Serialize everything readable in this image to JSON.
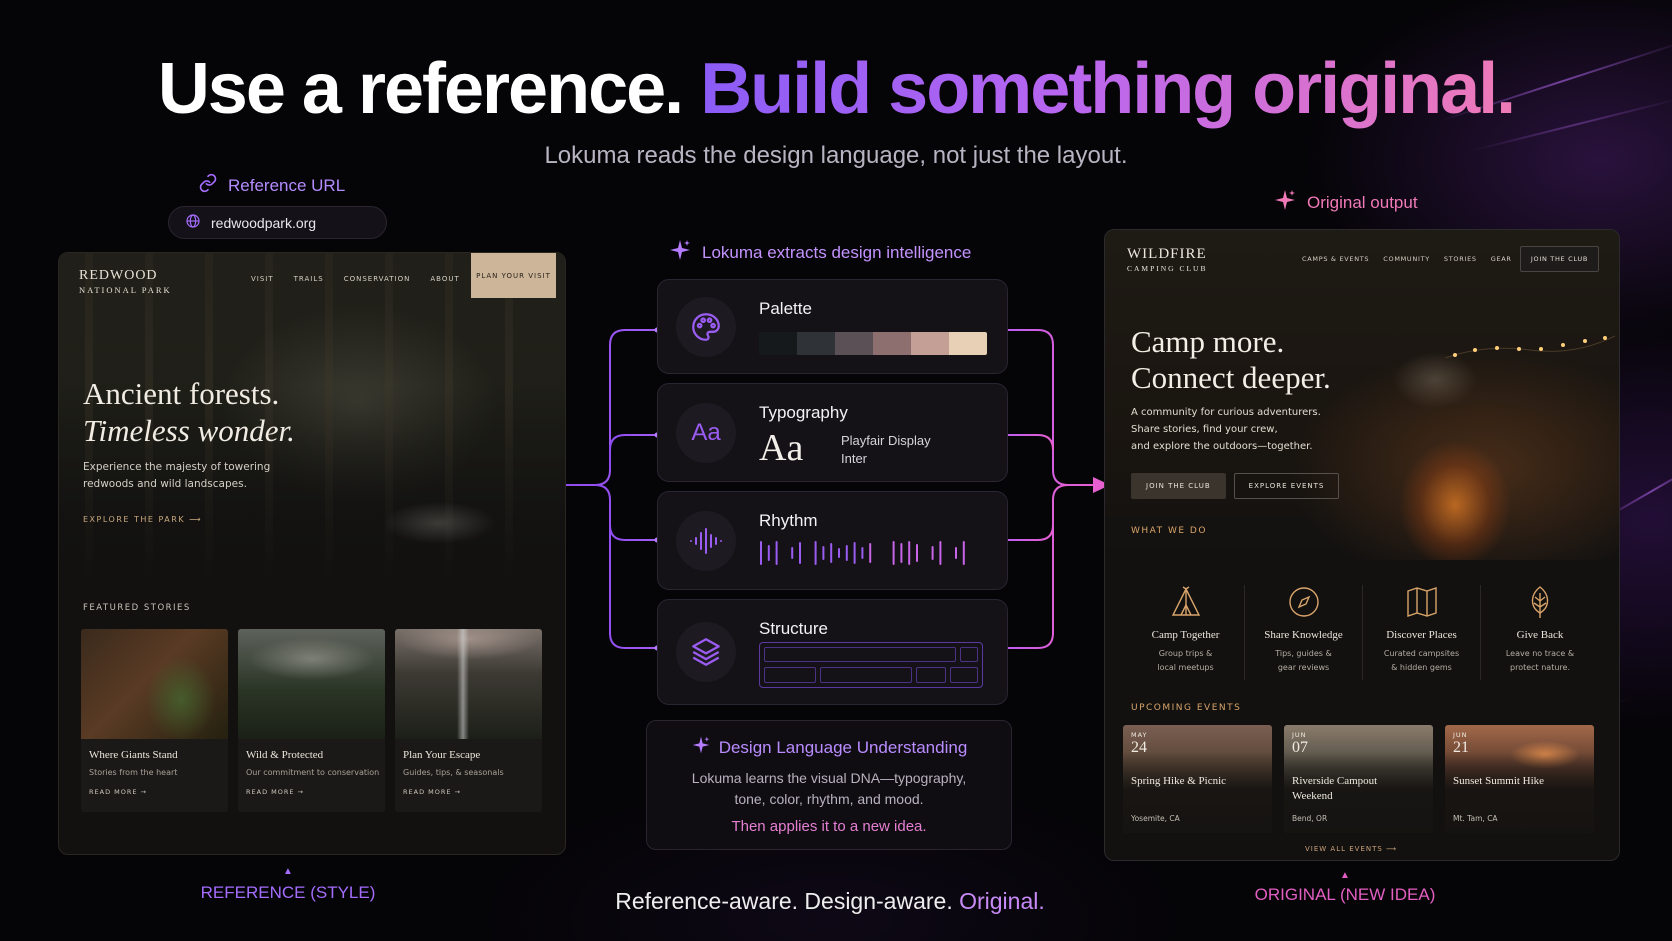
{
  "headline": {
    "part1": "Use a reference.",
    "part2": "Build something original."
  },
  "subhead": "Lokuma reads the design language, not just the layout.",
  "reference": {
    "label": "Reference URL",
    "url": "redwoodpark.org",
    "caption": "REFERENCE (STYLE)",
    "site": {
      "logo_line1": "REDWOOD",
      "logo_line2": "NATIONAL PARK",
      "nav": [
        "VISIT",
        "TRAILS",
        "CONSERVATION",
        "ABOUT"
      ],
      "cta": "PLAN YOUR VISIT",
      "h1_line1": "Ancient forests.",
      "h1_line2": "Timeless wonder.",
      "intro": "Experience the majesty of towering redwoods and wild landscapes.",
      "explore": "EXPLORE THE PARK  ⟶",
      "featured_title": "FEATURED STORIES",
      "cards": [
        {
          "title": "Where Giants Stand",
          "subtitle": "Stories from the heart",
          "link": "READ MORE  →"
        },
        {
          "title": "Wild & Protected",
          "subtitle": "Our commitment to conservation",
          "link": "READ MORE  →"
        },
        {
          "title": "Plan Your Escape",
          "subtitle": "Guides, tips, & seasonals",
          "link": "READ MORE  →"
        }
      ]
    }
  },
  "extraction": {
    "label": "Lokuma extracts design intelligence",
    "palette": {
      "title": "Palette",
      "colors": [
        "#16191c",
        "#2f3236",
        "#5a5055",
        "#8d6f70",
        "#c49f96",
        "#e8d0b6"
      ]
    },
    "typography": {
      "title": "Typography",
      "sample": "Aa",
      "icon_text": "Aa",
      "font1": "Playfair Display",
      "font2": "Inter"
    },
    "rhythm": {
      "title": "Rhythm"
    },
    "structure": {
      "title": "Structure"
    }
  },
  "dlu": {
    "title": "Design Language Understanding",
    "body_line1": "Lokuma learns the visual DNA—typography,",
    "body_line2": "tone, color, rhythm, and mood.",
    "accent": "Then applies it to a new idea."
  },
  "tagline": {
    "plain": "Reference-aware. Design-aware.",
    "accent": "Original."
  },
  "output": {
    "label": "Original output",
    "caption": "ORIGINAL (NEW IDEA)",
    "site": {
      "logo_line1": "WILDFIRE",
      "logo_line2": "CAMPING CLUB",
      "nav": [
        "CAMPS & EVENTS",
        "COMMUNITY",
        "STORIES",
        "GEAR"
      ],
      "cta": "JOIN THE CLUB",
      "h1_line1": "Camp more.",
      "h1_line2": "Connect deeper.",
      "intro_line1": "A community for curious adventurers.",
      "intro_line2": "Share stories, find your crew,",
      "intro_line3": "and explore the outdoors—together.",
      "btn_primary": "JOIN THE CLUB",
      "btn_secondary": "EXPLORE EVENTS",
      "what_we_do": "WHAT WE DO",
      "services": [
        {
          "title": "Camp Together",
          "line1": "Group trips &",
          "line2": "local meetups",
          "icon": "tent-icon"
        },
        {
          "title": "Share Knowledge",
          "line1": "Tips, guides &",
          "line2": "gear reviews",
          "icon": "compass-icon"
        },
        {
          "title": "Discover Places",
          "line1": "Curated campsites",
          "line2": "& hidden gems",
          "icon": "map-icon"
        },
        {
          "title": "Give Back",
          "line1": "Leave no trace &",
          "line2": "protect nature.",
          "icon": "leaf-icon"
        }
      ],
      "upcoming": "UPCOMING EVENTS",
      "events": [
        {
          "month": "MAY",
          "day": "24",
          "title": "Spring Hike & Picnic",
          "location": "Yosemite, CA"
        },
        {
          "month": "JUN",
          "day": "07",
          "title": "Riverside Campout Weekend",
          "location": "Bend, OR"
        },
        {
          "month": "JUN",
          "day": "21",
          "title": "Sunset Summit Hike",
          "location": "Mt. Tam, CA"
        }
      ],
      "view_all": "VIEW ALL EVENTS  ⟶"
    }
  }
}
